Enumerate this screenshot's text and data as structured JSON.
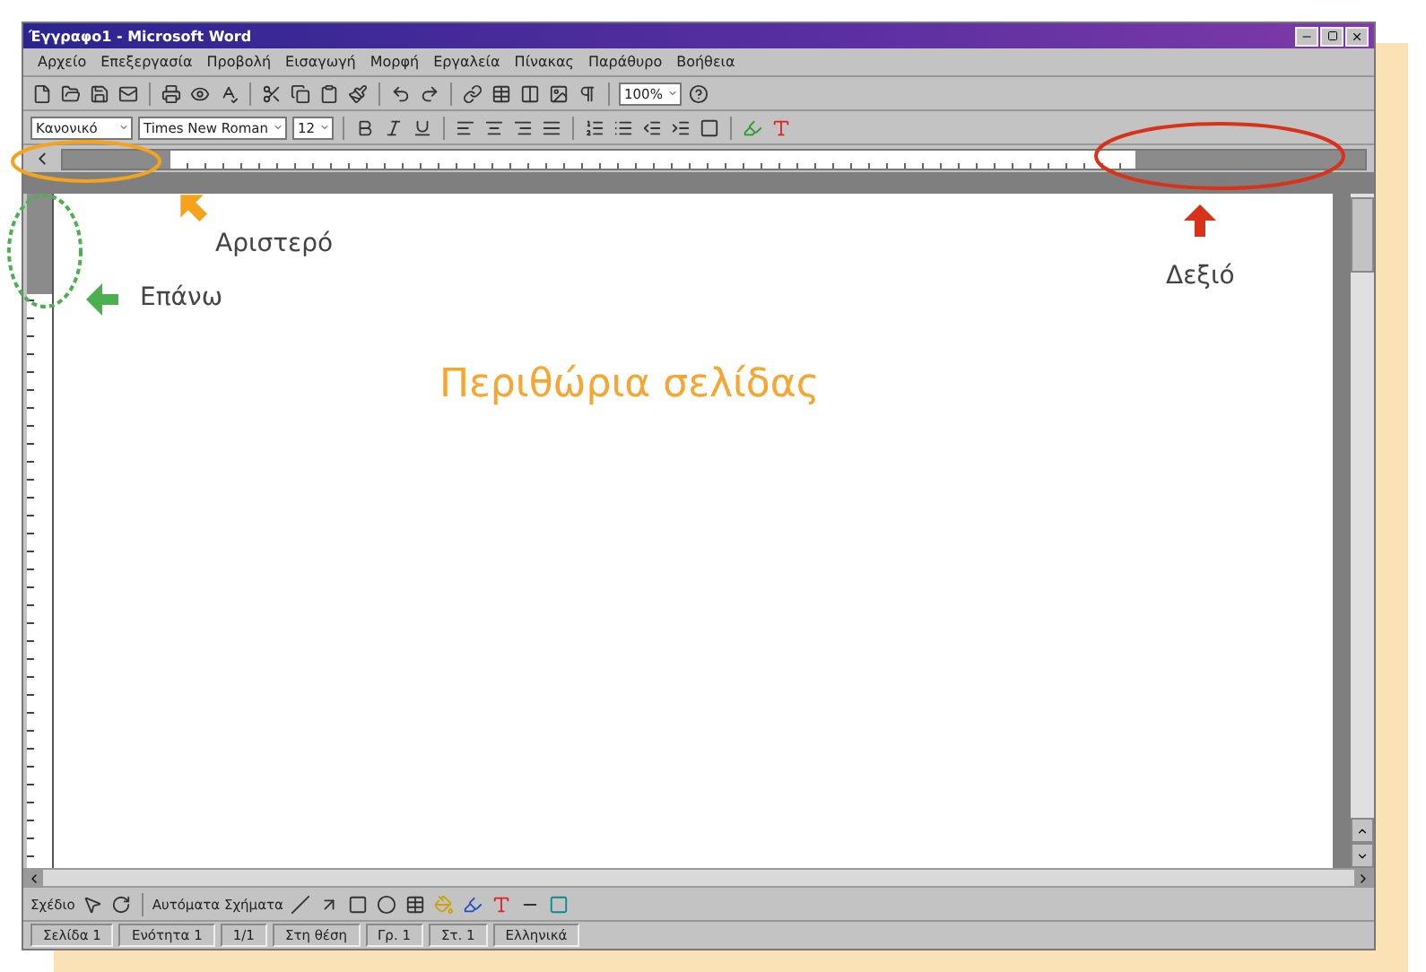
{
  "window": {
    "title": "Έγγραφο1 - Microsoft Word"
  },
  "menu": [
    "Αρχείο",
    "Επεξεργασία",
    "Προβολή",
    "Εισαγωγή",
    "Μορφή",
    "Εργαλεία",
    "Πίνακας",
    "Παράθυρο",
    "Βοήθεια"
  ],
  "standard_toolbar": {
    "zoom": "100%"
  },
  "formatting_toolbar": {
    "style": "Κανονικό",
    "font": "Times New Roman",
    "size": "12"
  },
  "page": {
    "heading": "Περιθώρια σελίδας"
  },
  "annotations": [
    {
      "kind": "left",
      "label": "Αριστερό",
      "color": "#f5a21c"
    },
    {
      "kind": "top",
      "label": "Επάνω",
      "color": "#4caf50"
    },
    {
      "kind": "right",
      "label": "Δεξιό",
      "color": "#d8321a"
    }
  ],
  "drawing_toolbar": {
    "draw": "Σχέδιο",
    "autoshapes": "Αυτόματα Σχήματα"
  },
  "status_bar": [
    "Σελίδα 1",
    "Ενότητα 1",
    "1/1",
    "Στη θέση",
    "Γρ. 1",
    "Στ. 1",
    "Ελληνικά"
  ]
}
